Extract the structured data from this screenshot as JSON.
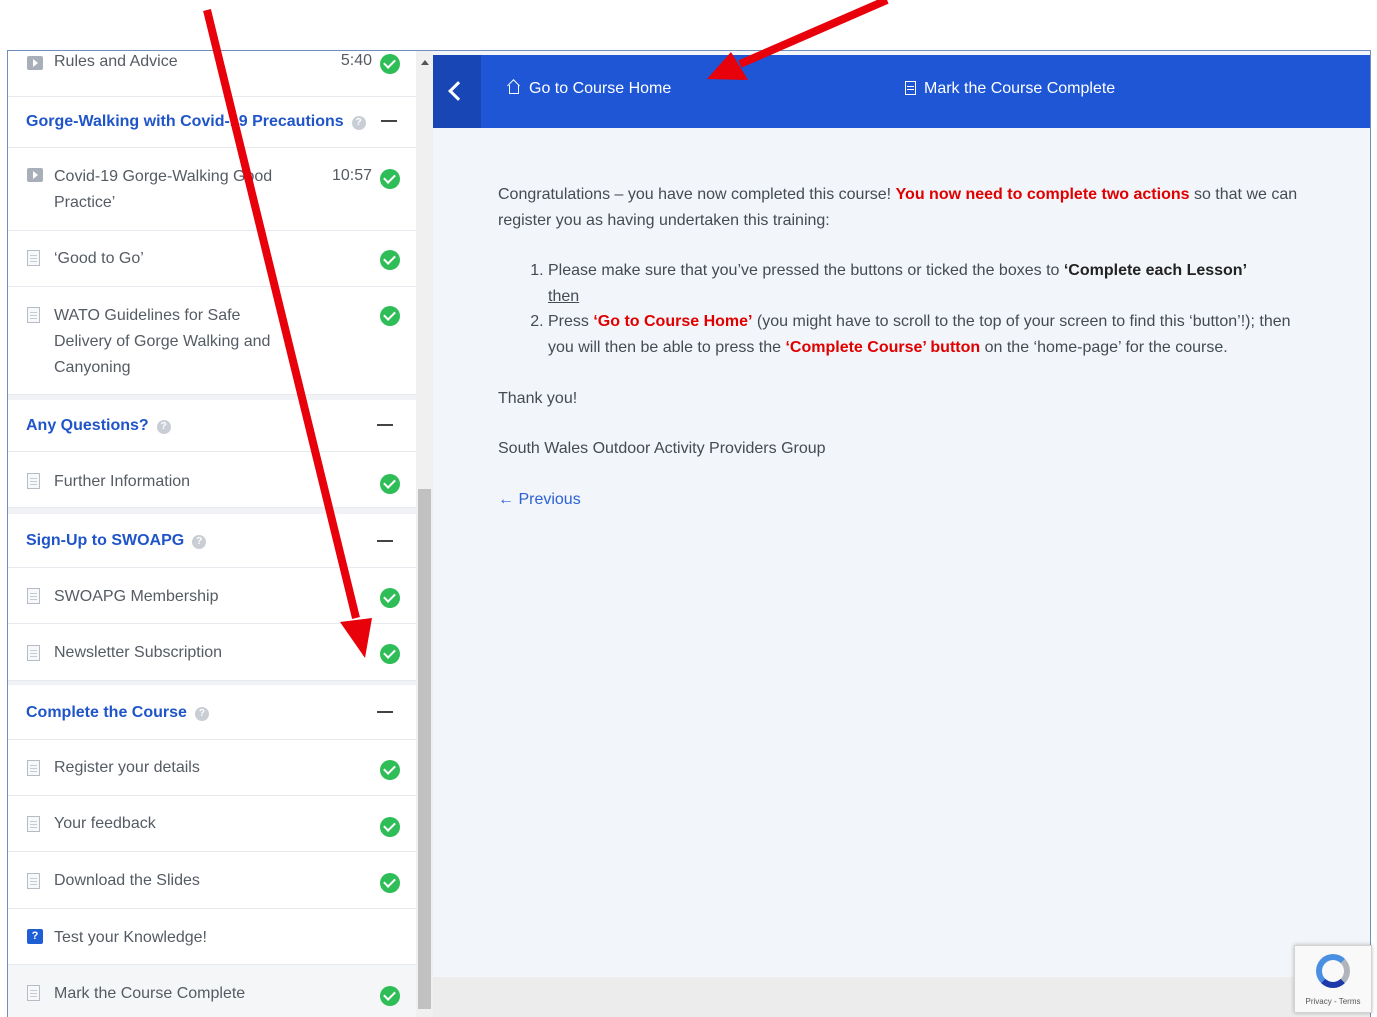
{
  "sidebar": {
    "items": [
      {
        "title": "Rules and Advice",
        "duration": "5:40",
        "type": "video",
        "done": true
      },
      {
        "section": "Gorge-Walking with Covid-19 Precautions"
      },
      {
        "title": "Covid-19 Gorge-Walking Good Practice’",
        "duration": "10:57",
        "type": "video",
        "done": true
      },
      {
        "title": "‘Good to Go’",
        "type": "doc",
        "done": true
      },
      {
        "title": "WATO Guidelines for Safe Delivery of Gorge Walking and Canyoning",
        "type": "doc",
        "done": true
      },
      {
        "section": "Any Questions?"
      },
      {
        "title": "Further Information",
        "type": "doc",
        "done": true
      },
      {
        "section": "Sign-Up to SWOAPG"
      },
      {
        "title": "SWOAPG Membership",
        "type": "doc",
        "done": true
      },
      {
        "title": "Newsletter Subscription",
        "type": "doc",
        "done": true
      },
      {
        "section": "Complete the Course"
      },
      {
        "title": "Register your details",
        "type": "doc",
        "done": true
      },
      {
        "title": "Your feedback",
        "type": "doc",
        "done": true
      },
      {
        "title": "Download the Slides",
        "type": "doc",
        "done": true
      },
      {
        "title": "Test your Knowledge!",
        "type": "quiz",
        "done": false
      },
      {
        "title": "Mark the Course Complete",
        "type": "doc",
        "done": true
      }
    ],
    "help_glyph": "?"
  },
  "topbar": {
    "home_label": "Go to Course Home",
    "complete_label": "Mark the Course Complete"
  },
  "content": {
    "intro_a": "Congratulations – you have now completed this course! ",
    "intro_red": "You now need to complete two actions",
    "intro_b": " so that we can register you as having undertaken this training:",
    "step1_a": "Please make sure that you’ve pressed the buttons or ticked the boxes to ",
    "step1_strong": "‘Complete each Lesson’",
    "step1_then": "then",
    "step2_a": "Press ",
    "step2_red1": "‘Go to Course Home’",
    "step2_b": " (you might have to scroll to the top of your screen to find this ‘button’!); then you will then be able to press the ",
    "step2_red2": "‘Complete Course’ button",
    "step2_c": " on the ‘home-page’ for the course.",
    "thanks": "Thank you!",
    "signature": "South Wales Outdoor Activity Providers Group",
    "previous": "← Previous"
  },
  "recaptcha": {
    "text": "Privacy - Terms"
  },
  "colors": {
    "accent": "#1e56d6",
    "done": "#2fbd58",
    "highlight": "#e00000",
    "annotation_arrow": "#e8000b"
  }
}
